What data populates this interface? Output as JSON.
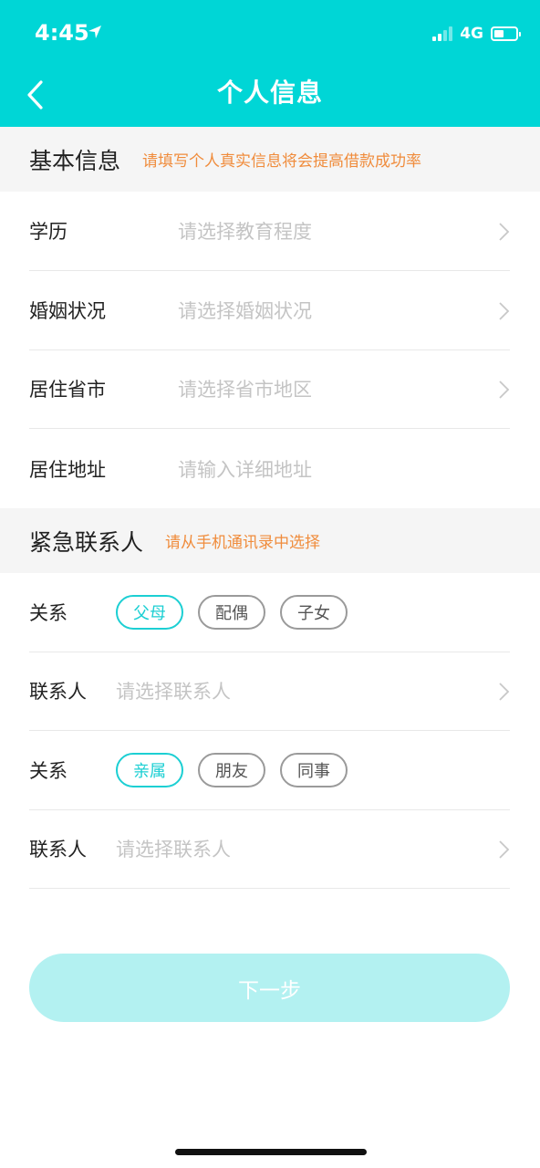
{
  "status_bar": {
    "time": "4:45",
    "network": "4G",
    "battery_level": 0.45
  },
  "nav": {
    "title": "个人信息"
  },
  "basic_section": {
    "title": "基本信息",
    "hint": "请填写个人真实信息将会提高借款成功率",
    "rows": [
      {
        "label": "学历",
        "placeholder": "请选择教育程度"
      },
      {
        "label": "婚姻状况",
        "placeholder": "请选择婚姻状况"
      },
      {
        "label": "居住省市",
        "placeholder": "请选择省市地区"
      },
      {
        "label": "居住地址",
        "placeholder": "请输入详细地址"
      }
    ]
  },
  "emergency_section": {
    "title": "紧急联系人",
    "hint": "请从手机通讯录中选择",
    "relation_label": "关系",
    "contact_label": "联系人",
    "contact_placeholder": "请选择联系人",
    "group1_options": [
      "父母",
      "配偶",
      "子女"
    ],
    "group1_selected": "父母",
    "group2_options": [
      "亲属",
      "朋友",
      "同事"
    ],
    "group2_selected": "亲属"
  },
  "next_button": "下一步",
  "colors": {
    "primary": "#00d6d6",
    "accent_text": "#f08c3c",
    "chip_active": "#1ccfd3",
    "button_disabled": "#b3f1f1"
  }
}
